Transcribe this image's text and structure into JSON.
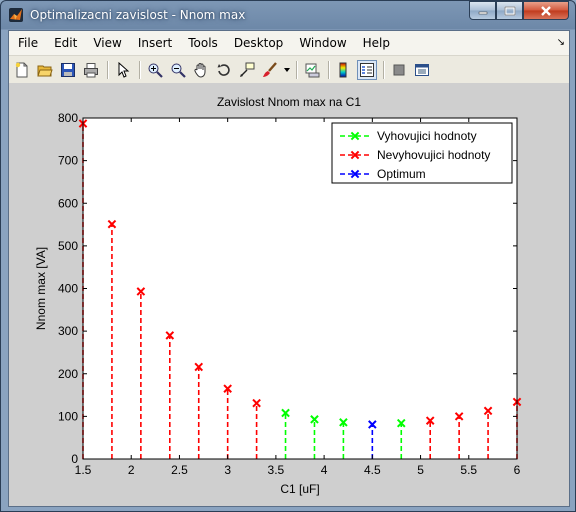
{
  "window": {
    "title": "Optimalizacni zavislost - Nnom max"
  },
  "menu": {
    "items": [
      "File",
      "Edit",
      "View",
      "Insert",
      "Tools",
      "Desktop",
      "Window",
      "Help"
    ]
  },
  "toolbar": {
    "icons": [
      "new-figure-icon",
      "open-file-icon",
      "save-icon",
      "print-icon",
      "pointer-icon",
      "zoom-in-icon",
      "zoom-out-icon",
      "pan-icon",
      "rotate-icon",
      "data-cursor-icon",
      "brush-icon",
      "brush-dropdown-icon",
      "link-plot-icon",
      "colorbar-icon",
      "legend-icon",
      "hide-plot-tools-icon",
      "show-plot-tools-icon"
    ]
  },
  "colors": {
    "green": "#00ff00",
    "red": "#ff0000",
    "blue": "#0000ff",
    "plot_bg": "#ffffff",
    "figure_bg": "#cfcfcf"
  },
  "chart_data": {
    "type": "stem",
    "title": "Zavislost Nnom max na C1",
    "xlabel": "C1 [uF]",
    "ylabel": "Nnom max [VA]",
    "xlim": [
      1.5,
      6
    ],
    "ylim": [
      0,
      800
    ],
    "xticks": [
      "1.5",
      "2",
      "2.5",
      "3",
      "3.5",
      "4",
      "4.5",
      "5",
      "5.5",
      "6"
    ],
    "yticks": [
      "0",
      "100",
      "200",
      "300",
      "400",
      "500",
      "600",
      "700",
      "800"
    ],
    "legend_position": "top-right",
    "series": [
      {
        "name": "Vyhovujici hodnoty",
        "color": "#00ff00",
        "points": [
          [
            3.6,
            108
          ],
          [
            3.9,
            93
          ],
          [
            4.2,
            86
          ],
          [
            4.8,
            84
          ]
        ]
      },
      {
        "name": "Nevyhovujici hodnoty",
        "color": "#ff0000",
        "points": [
          [
            1.5,
            787
          ],
          [
            1.8,
            551
          ],
          [
            2.1,
            393
          ],
          [
            2.4,
            290
          ],
          [
            2.7,
            216
          ],
          [
            3.0,
            165
          ],
          [
            3.3,
            131
          ],
          [
            5.1,
            90
          ],
          [
            5.4,
            100
          ],
          [
            5.7,
            113
          ],
          [
            6.0,
            134
          ]
        ]
      },
      {
        "name": "Optimum",
        "color": "#0000ff",
        "points": [
          [
            4.5,
            81
          ]
        ]
      }
    ]
  }
}
